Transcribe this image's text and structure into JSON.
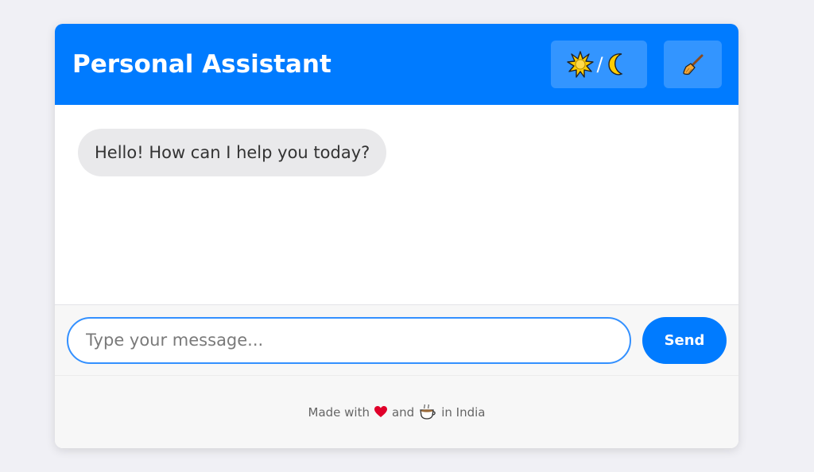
{
  "header": {
    "title": "Personal Assistant",
    "theme_toggle_slash": "/",
    "theme_toggle_icons": [
      "sun-icon",
      "moon-icon"
    ],
    "clear_icon": "broom-icon"
  },
  "messages": [
    {
      "role": "assistant",
      "text": "Hello! How can I help you today?"
    }
  ],
  "composer": {
    "placeholder": "Type your message...",
    "value": "",
    "send_label": "Send"
  },
  "footer": {
    "made_with": "Made with",
    "and": "and",
    "in_india": "in India",
    "icons": [
      "heart-icon",
      "tea-cup-icon"
    ]
  },
  "colors": {
    "accent": "#007bff",
    "bubble_bg": "#e9e9eb",
    "heart": "#e0002a"
  }
}
